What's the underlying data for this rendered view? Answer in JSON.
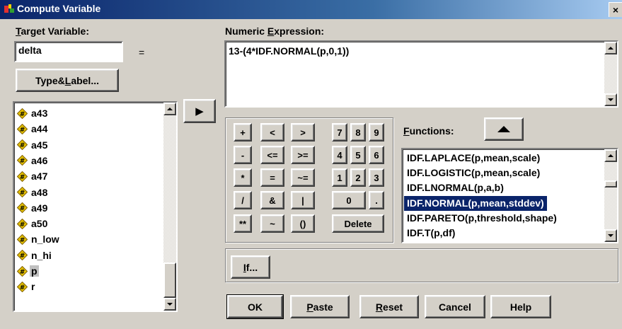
{
  "window": {
    "title": "Compute Variable",
    "close_glyph": "×"
  },
  "target": {
    "label_pre": "",
    "label_u": "T",
    "label_post": "arget Variable:",
    "value": "delta",
    "equals": "="
  },
  "type_label_button": {
    "pre": "Type&",
    "u": "L",
    "post": "abel..."
  },
  "move_arrow": "▶",
  "expression": {
    "label_pre": "Numeric ",
    "label_u": "E",
    "label_post": "xpression:",
    "value": "13-(4*IDF.NORMAL(p,0,1))"
  },
  "variables": [
    "a43",
    "a44",
    "a45",
    "a46",
    "a47",
    "a48",
    "a49",
    "a50",
    "n_low",
    "n_hi",
    "p",
    "r"
  ],
  "selected_variable": "p",
  "keypad": {
    "row1": [
      "+",
      "<",
      ">",
      "7",
      "8",
      "9"
    ],
    "row2": [
      "-",
      "<=",
      ">=",
      "4",
      "5",
      "6"
    ],
    "row3": [
      "*",
      "=",
      "~=",
      "1",
      "2",
      "3"
    ],
    "row4": [
      "/",
      "&",
      "|",
      "0",
      "."
    ],
    "row5": [
      "**",
      "~",
      "()",
      "Delete"
    ]
  },
  "functions": {
    "label_u": "F",
    "label_post": "unctions:",
    "items": [
      "IDF.LAPLACE(p,mean,scale)",
      "IDF.LOGISTIC(p,mean,scale)",
      "IDF.LNORMAL(p,a,b)",
      "IDF.NORMAL(p,mean,stddev)",
      "IDF.PARETO(p,threshold,shape)",
      "IDF.T(p,df)"
    ],
    "selected": "IDF.NORMAL(p,mean,stddev)"
  },
  "if_button": {
    "u": "I",
    "post": "f..."
  },
  "buttons": {
    "ok": "OK",
    "paste": {
      "u": "P",
      "post": "aste"
    },
    "reset": {
      "u": "R",
      "post": "eset"
    },
    "cancel": "Cancel",
    "help": "Help"
  },
  "colors": {
    "face": "#d4d0c8",
    "title_start": "#0a246a",
    "selection": "#0a246a",
    "var_icon": "#e8c400"
  }
}
